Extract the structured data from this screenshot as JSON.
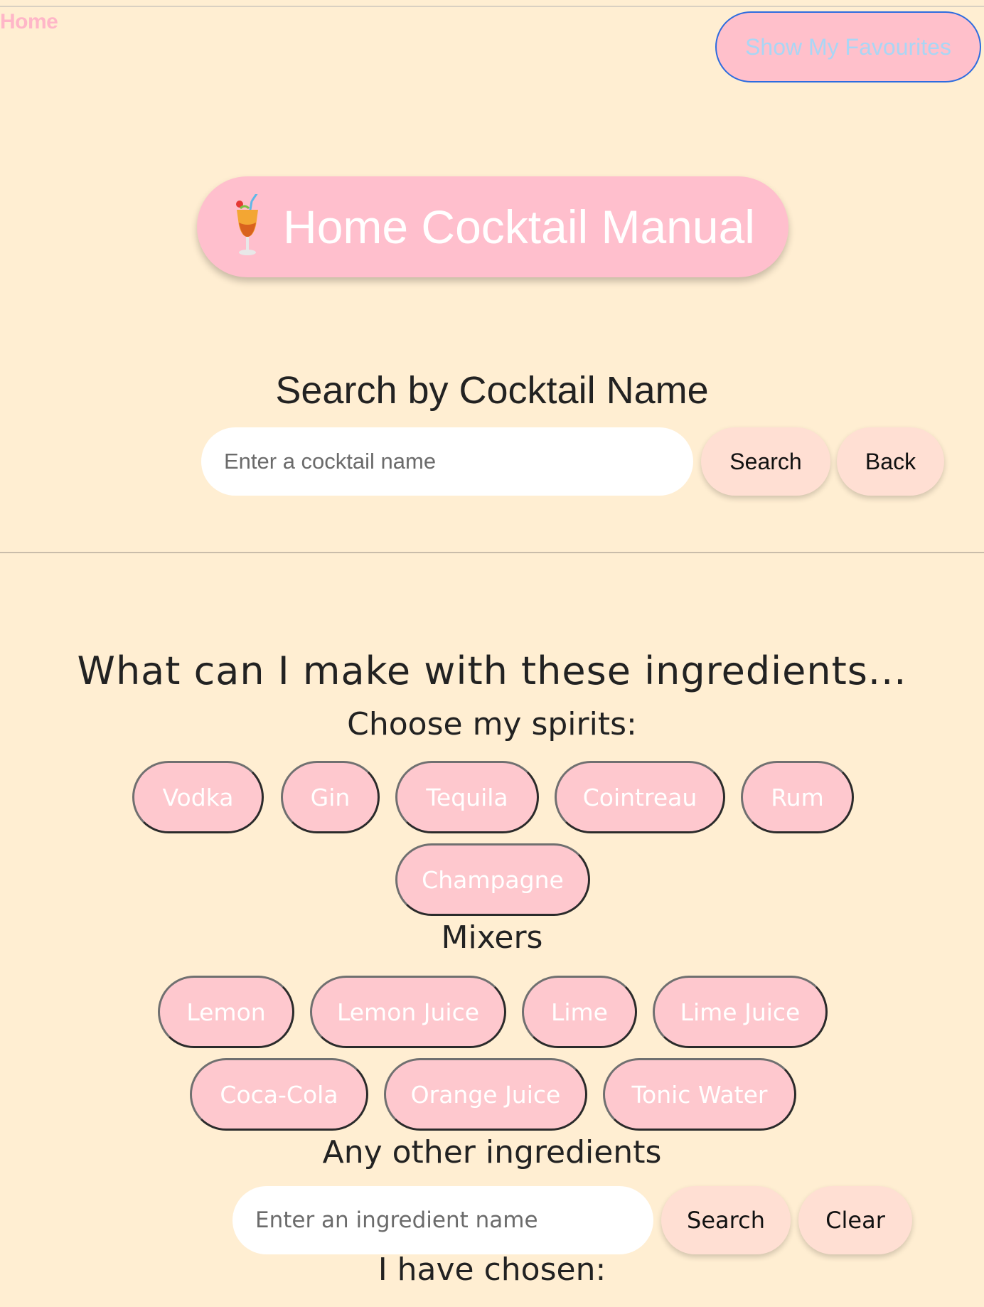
{
  "nav": {
    "home_label": "Home",
    "favourites_label": "Show My Favourites"
  },
  "header": {
    "title": "Home Cocktail Manual",
    "icon": "cocktail-glass-icon"
  },
  "name_search": {
    "heading": "Search by Cocktail Name",
    "placeholder": "Enter a cocktail name",
    "value": "",
    "search_label": "Search",
    "back_label": "Back"
  },
  "ingredients": {
    "heading": "What can I make with these ingredients...",
    "spirits_heading": "Choose my spirits:",
    "spirits": [
      "Vodka",
      "Gin",
      "Tequila",
      "Cointreau",
      "Rum",
      "Champagne"
    ],
    "mixers_heading": "Mixers",
    "mixers": [
      "Lemon",
      "Lemon Juice",
      "Lime",
      "Lime Juice",
      "Coca-Cola",
      "Orange Juice",
      "Tonic Water"
    ],
    "other_heading": "Any other ingredients",
    "other_placeholder": "Enter an ingredient name",
    "other_value": "",
    "search_label": "Search",
    "clear_label": "Clear",
    "chosen_heading": "I have chosen:"
  },
  "colors": {
    "background": "#ffeed2",
    "accent_pink": "#ffbfcd",
    "chip_pink": "#fec8ce",
    "soft_button": "#ffdfd3",
    "link_pink": "#ffb6c8",
    "favourites_border": "#2d6cdf",
    "favourites_text": "#a9d6f5"
  }
}
